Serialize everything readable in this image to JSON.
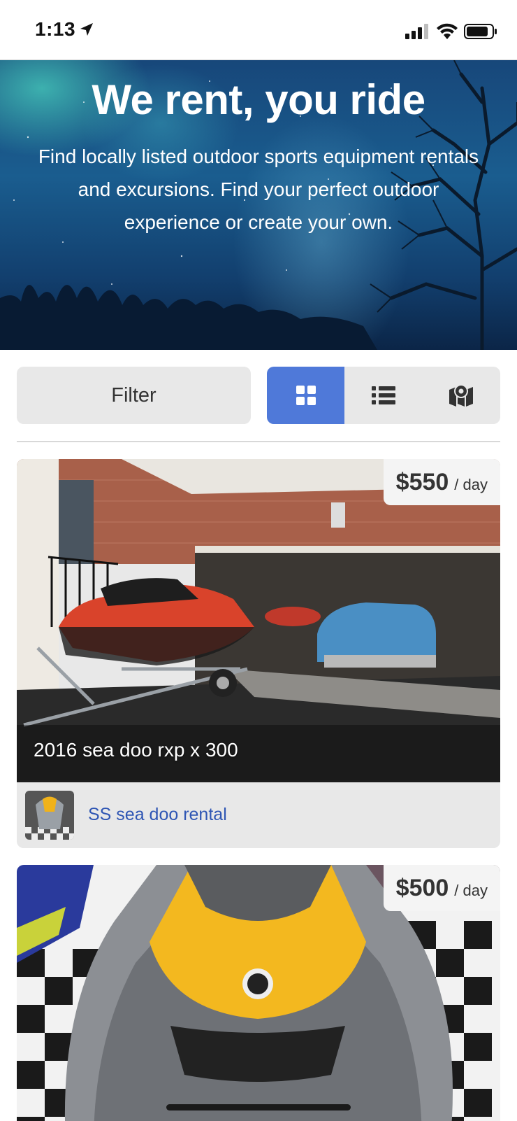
{
  "status_bar": {
    "time": "1:13"
  },
  "hero": {
    "title": "We rent, you ride",
    "subtitle": "Find locally listed outdoor sports equipment rentals and excursions. Find your perfect outdoor experience or create your own."
  },
  "controls": {
    "filter_label": "Filter",
    "views": [
      {
        "name": "grid",
        "icon": "grid-icon",
        "active": true
      },
      {
        "name": "list",
        "icon": "list-icon",
        "active": false
      },
      {
        "name": "map",
        "icon": "map-icon",
        "active": false
      }
    ],
    "active_color": "#4f79d9"
  },
  "listings": [
    {
      "price": "$550",
      "unit": "/ day",
      "title": "2016 sea doo rxp x 300",
      "owner": "SS sea doo rental"
    },
    {
      "price": "$500",
      "unit": "/ day",
      "title": "",
      "owner": ""
    }
  ],
  "colors": {
    "link": "#2f56b4",
    "card_bg": "#e8e8e8"
  }
}
